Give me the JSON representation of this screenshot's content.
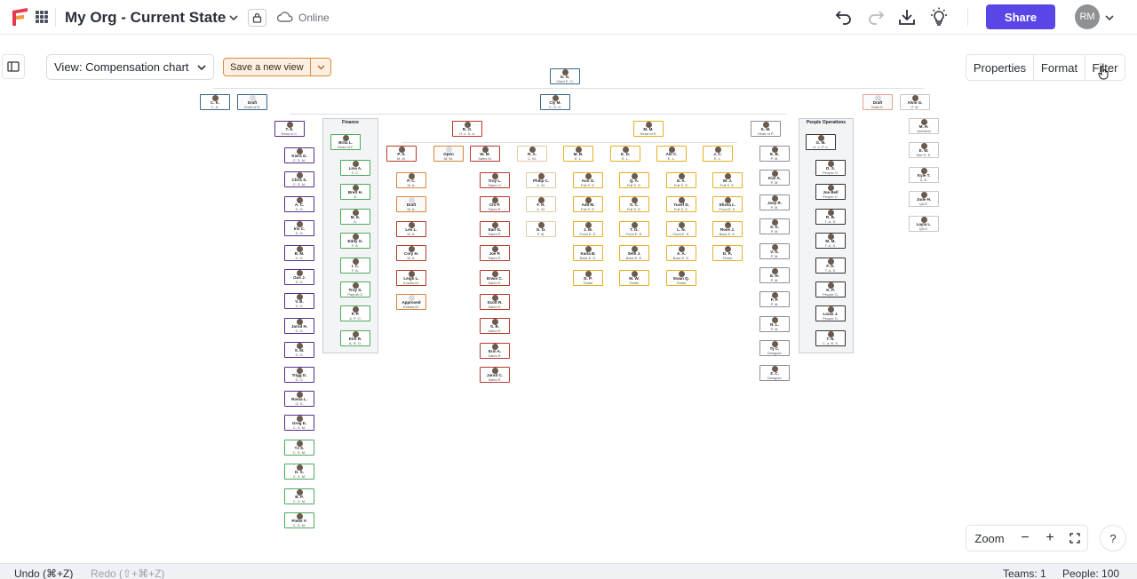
{
  "app": {
    "title": "My Org - Current State",
    "status": "Online",
    "share_label": "Share",
    "user_initials": "RM",
    "accent_color": "#5a46e6"
  },
  "toolbar": {
    "icons": [
      "undo-icon",
      "redo-icon",
      "download-icon",
      "lightbulb-icon"
    ]
  },
  "view": {
    "label": "View: Compensation chart",
    "save_label": "Save a new view"
  },
  "right_tabs": [
    "Properties",
    "Format",
    "Filter"
  ],
  "zoom": {
    "label": "Zoom",
    "minus": "−",
    "plus": "+"
  },
  "help": "?",
  "bottom": {
    "undo": "Undo (⌘+Z)",
    "redo": "Redo (⇧+⌘+Z)",
    "teams": "Teams: 1",
    "people": "People: 100"
  },
  "groups": {
    "finance": "Finance",
    "people_ops": "People Operations"
  },
  "org": {
    "root": {
      "name": "G. G.",
      "role": "Chief E. O.",
      "color": "blue"
    },
    "top_row": [
      {
        "name": "C. K.",
        "role": "C. A.",
        "color": "blue"
      },
      {
        "name": "Draft",
        "role": "Chief of S.",
        "color": "blue",
        "ghost": true
      },
      {
        "name": "Cly M.",
        "role": "C. O. O.",
        "color": "blue"
      },
      {
        "name": "Draft",
        "role": "Data S.",
        "color": "salmon",
        "ghost": true
      },
      {
        "name": "Alvin G.",
        "role": "IT M.",
        "color": "lgray"
      }
    ],
    "heads": [
      {
        "name": "T. E.",
        "role": "Head of C.",
        "color": "purple"
      },
      {
        "name": "R. O.",
        "role": "H. o. S. a.",
        "color": "red"
      },
      {
        "name": "M. M.",
        "role": "Head of E.",
        "color": "yellow"
      },
      {
        "name": "K. M.",
        "role": "Head of P.",
        "color": "gray"
      }
    ],
    "col_purple": [
      {
        "name": "Kiera G.",
        "role": "C. S. M.",
        "color": "purple"
      },
      {
        "name": "Chris S.",
        "role": "C. S. M.",
        "color": "purple"
      },
      {
        "name": "A. C.",
        "role": "S. O.",
        "color": "purple"
      },
      {
        "name": "Iris C.",
        "role": "S. O.",
        "color": "purple"
      },
      {
        "name": "B. M.",
        "role": "S. O.",
        "color": "purple"
      },
      {
        "name": "Gus J.",
        "role": "S. O.",
        "color": "purple"
      },
      {
        "name": "V. B.",
        "role": "S. O.",
        "color": "purple"
      },
      {
        "name": "Jarod H.",
        "role": "S. O.",
        "color": "purple"
      },
      {
        "name": "S. M.",
        "role": "S. O.",
        "color": "purple"
      },
      {
        "name": "Trigg D.",
        "role": "S. O.",
        "color": "purple"
      },
      {
        "name": "Roma L.",
        "role": "O. S.",
        "color": "purple"
      },
      {
        "name": "Greg E.",
        "role": "C. S. M.",
        "color": "purple"
      },
      {
        "name": "TJ S.",
        "role": "C. S. M.",
        "color": "green"
      },
      {
        "name": "D. S.",
        "role": "C. S. M.",
        "color": "green"
      },
      {
        "name": "B. P.",
        "role": "C. S. M.",
        "color": "green"
      },
      {
        "name": "Pieter F.",
        "role": "C. S. M.",
        "color": "green"
      }
    ],
    "finance_head": {
      "name": "Brita L.",
      "role": "Head of F.",
      "color": "green"
    },
    "col_finance": [
      {
        "name": "Lina A.",
        "role": "F. C.",
        "color": "green"
      },
      {
        "name": "Brett H.",
        "role": "A.",
        "color": "green"
      },
      {
        "name": "M. E.",
        "role": "A.",
        "color": "green"
      },
      {
        "name": "Eddy G.",
        "role": "F. A.",
        "color": "green"
      },
      {
        "name": "I. C.",
        "role": "F. A.",
        "color": "green"
      },
      {
        "name": "Troy S.",
        "role": "Payroll O.",
        "color": "green"
      },
      {
        "name": "P. P.",
        "role": "A. P. O.",
        "color": "green"
      },
      {
        "name": "Kirk R.",
        "role": "A. R. O.",
        "color": "green"
      }
    ],
    "sales_subheads": [
      {
        "name": "P. S.",
        "role": "M. M.",
        "color": "red"
      },
      {
        "name": "Open",
        "role": "M. M.",
        "color": "orange",
        "ghost": true
      },
      {
        "name": "W. M.",
        "role": "Sales M.",
        "color": "red"
      },
      {
        "name": "R. A.",
        "role": "C. M.",
        "color": "tan"
      }
    ],
    "col_ps": [
      {
        "name": "P. C.",
        "role": "M. A.",
        "color": "orange"
      },
      {
        "name": "Draft",
        "role": "M. A.",
        "color": "orange",
        "ghost": true
      },
      {
        "name": "Leo L.",
        "role": "M. A.",
        "color": "red"
      },
      {
        "name": "Cory H.",
        "role": "M. A.",
        "color": "red"
      },
      {
        "name": "Leigh L.",
        "role": "Events M.",
        "color": "red"
      },
      {
        "name": "Approved",
        "role": "Events M.",
        "color": "orange",
        "ghost": true
      }
    ],
    "col_wm": [
      {
        "name": "Troy L.",
        "role": "Sales O.",
        "color": "red"
      },
      {
        "name": "Chi P.",
        "role": "Sales R.",
        "color": "red"
      },
      {
        "name": "Earl G.",
        "role": "Sales R.",
        "color": "red"
      },
      {
        "name": "Joe P.",
        "role": "Sales R.",
        "color": "red"
      },
      {
        "name": "Erwin C.",
        "role": "Sales R.",
        "color": "red"
      },
      {
        "name": "Scott R.",
        "role": "Sales R.",
        "color": "red"
      },
      {
        "name": "S. B.",
        "role": "Sales R.",
        "color": "red"
      },
      {
        "name": "Erin A.",
        "role": "Sales R.",
        "color": "red"
      },
      {
        "name": "Jarod C.",
        "role": "Sales R.",
        "color": "red"
      }
    ],
    "col_ra": [
      {
        "name": "Philip C.",
        "role": "C. M.",
        "color": "tan"
      },
      {
        "name": "F. H.",
        "role": "C. M.",
        "color": "tan"
      },
      {
        "name": "G. D.",
        "role": "P. M.",
        "color": "tan"
      }
    ],
    "eng_subheads": [
      {
        "name": "M. B.",
        "role": "E. L.",
        "color": "yellow"
      },
      {
        "name": "K. D.",
        "role": "E. L.",
        "color": "yellow"
      },
      {
        "name": "Alil C.",
        "role": "E. L.",
        "color": "yellow"
      },
      {
        "name": "J. C.",
        "role": "E. L.",
        "color": "yellow"
      }
    ],
    "col_e1": [
      {
        "name": "Ann O.",
        "role": "Full S. E.",
        "color": "yellow"
      },
      {
        "name": "Adil M.",
        "role": "Full S. E.",
        "color": "yellow"
      },
      {
        "name": "J. M.",
        "role": "Front E. E.",
        "color": "yellow"
      },
      {
        "name": "Karla B.",
        "role": "Back E. E.",
        "color": "yellow"
      },
      {
        "name": "D. P.",
        "role": "Tester",
        "color": "yellow"
      }
    ],
    "col_e2": [
      {
        "name": "Q. A.",
        "role": "Full S. E.",
        "color": "yellow"
      },
      {
        "name": "S. C.",
        "role": "Full S. E.",
        "color": "yellow"
      },
      {
        "name": "T. G.",
        "role": "Front E. E.",
        "color": "yellow"
      },
      {
        "name": "Seth J.",
        "role": "Back E. E.",
        "color": "yellow"
      },
      {
        "name": "M. W.",
        "role": "Tester",
        "color": "yellow"
      }
    ],
    "col_e3": [
      {
        "name": "E. A.",
        "role": "Full S. E.",
        "color": "yellow"
      },
      {
        "name": "Yusef D.",
        "role": "Full S. E.",
        "color": "yellow"
      },
      {
        "name": "L. N.",
        "role": "Front E. E.",
        "color": "yellow"
      },
      {
        "name": "A. A.",
        "role": "Back E. E.",
        "color": "yellow"
      },
      {
        "name": "Ewan Q.",
        "role": "Tester",
        "color": "yellow"
      }
    ],
    "col_e4": [
      {
        "name": "W. J.",
        "role": "Full S. E.",
        "color": "yellow"
      },
      {
        "name": "Elissa L.",
        "role": "Front E. E.",
        "color": "yellow"
      },
      {
        "name": "Rose J.",
        "role": "Back E. E.",
        "color": "yellow"
      },
      {
        "name": "D. R.",
        "role": "Tester",
        "color": "yellow"
      }
    ],
    "col_product": [
      {
        "name": "E. B.",
        "role": "P. M.",
        "color": "gray"
      },
      {
        "name": "Kim A.",
        "role": "P. M.",
        "color": "gray"
      },
      {
        "name": "Joey R.",
        "role": "P. M.",
        "color": "gray"
      },
      {
        "name": "S. K.",
        "role": "P. M.",
        "color": "gray"
      },
      {
        "name": "V. N.",
        "role": "P. M.",
        "color": "gray"
      },
      {
        "name": "E. H.",
        "role": "P. M.",
        "color": "gray"
      },
      {
        "name": "F. P.",
        "role": "P. M.",
        "color": "gray"
      },
      {
        "name": "R. L.",
        "role": "P. M.",
        "color": "gray"
      },
      {
        "name": "Ty C.",
        "role": "Designer",
        "color": "gray"
      },
      {
        "name": "Z. C.",
        "role": "Designer",
        "color": "gray"
      }
    ],
    "people_head": {
      "name": "G. M.",
      "role": "H. o. P. o.",
      "color": "black"
    },
    "col_people": [
      {
        "name": "D. S.",
        "role": "People O.",
        "color": "black"
      },
      {
        "name": "Joe Bell",
        "role": "People O.",
        "color": "black"
      },
      {
        "name": "R. B.",
        "role": "T. A. S.",
        "color": "black"
      },
      {
        "name": "M. M.",
        "role": "T. A. S.",
        "color": "black"
      },
      {
        "name": "F. D.",
        "role": "T. A. S.",
        "color": "black"
      },
      {
        "name": "K. P.",
        "role": "People O.",
        "color": "black"
      },
      {
        "name": "Louis J.",
        "role": "People O.",
        "color": "black"
      },
      {
        "name": "T. N.",
        "role": "C. a. B. S.",
        "color": "black"
      }
    ],
    "col_it": [
      {
        "name": "M. H.",
        "role": "Architect",
        "color": "lgray"
      },
      {
        "name": "E. W.",
        "role": "Site R. E.",
        "color": "lgray"
      },
      {
        "name": "Kyle T.",
        "role": "S. E.",
        "color": "lgray"
      },
      {
        "name": "Jude H.",
        "role": "QA E.",
        "color": "lgray"
      },
      {
        "name": "Layla L.",
        "role": "QA E.",
        "color": "lgray"
      }
    ]
  }
}
